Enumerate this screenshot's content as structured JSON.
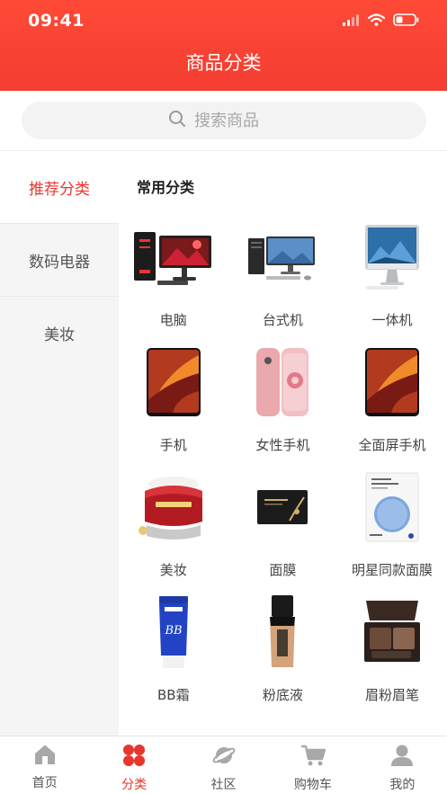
{
  "status_bar": {
    "time": "09:41"
  },
  "header": {
    "title": "商品分类"
  },
  "search": {
    "placeholder": "搜索商品"
  },
  "sidebar": {
    "items": [
      {
        "label": "推荐分类",
        "active": true
      },
      {
        "label": "数码电器",
        "active": false
      },
      {
        "label": "美妆",
        "active": false
      }
    ]
  },
  "content": {
    "section_title": "常用分类",
    "categories": [
      {
        "label": "电脑",
        "icon": "gaming-pc-icon"
      },
      {
        "label": "台式机",
        "icon": "desktop-computer-icon"
      },
      {
        "label": "一体机",
        "icon": "all-in-one-pc-icon"
      },
      {
        "label": "手机",
        "icon": "smartphone-icon"
      },
      {
        "label": "女性手机",
        "icon": "pink-smartphone-icon"
      },
      {
        "label": "全面屏手机",
        "icon": "fullscreen-phone-icon"
      },
      {
        "label": "美妆",
        "icon": "cream-jar-icon"
      },
      {
        "label": "面膜",
        "icon": "face-mask-pack-icon"
      },
      {
        "label": "明星同款面膜",
        "icon": "sheet-mask-icon"
      },
      {
        "label": "BB霜",
        "icon": "bb-cream-tube-icon"
      },
      {
        "label": "粉底液",
        "icon": "foundation-bottle-icon"
      },
      {
        "label": "眉粉眉笔",
        "icon": "eyebrow-palette-icon"
      }
    ]
  },
  "tabbar": {
    "tabs": [
      {
        "label": "首页",
        "icon": "home-icon",
        "active": false
      },
      {
        "label": "分类",
        "icon": "category-icon",
        "active": true
      },
      {
        "label": "社区",
        "icon": "planet-icon",
        "active": false
      },
      {
        "label": "购物车",
        "icon": "cart-icon",
        "active": false
      },
      {
        "label": "我的",
        "icon": "user-icon",
        "active": false
      }
    ]
  },
  "colors": {
    "accent": "#e8362d",
    "header": "#f33d31",
    "sidebar_bg": "#f5f5f5",
    "search_bg": "#f3f3f3"
  }
}
